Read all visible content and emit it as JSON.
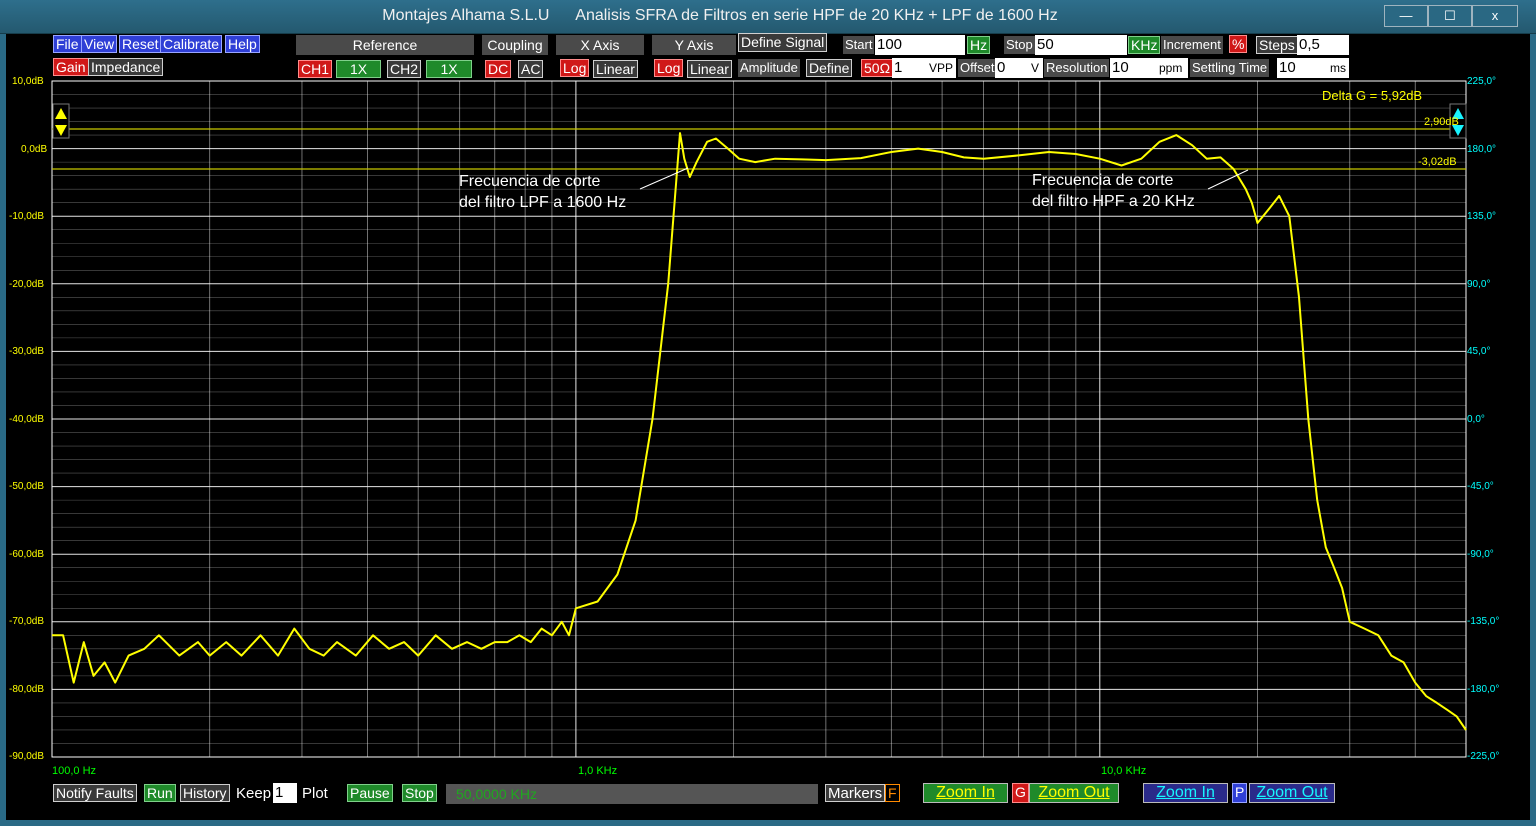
{
  "window": {
    "title": "Montajes Alhama S.L.U      Analisis SFRA de Filtros en serie HPF de 20 KHz + LPF de 1600 Hz",
    "minimize": "—",
    "maximize": "☐",
    "close": "x"
  },
  "menu": [
    "File",
    "View",
    "Reset",
    "Calibrate",
    "Help"
  ],
  "mode": {
    "gain": "Gain",
    "impedance": "Impedance"
  },
  "headers": {
    "reference": "Reference",
    "coupling": "Coupling",
    "x_axis": "X Axis",
    "y_axis": "Y Axis"
  },
  "reference": {
    "ch1": "CH1",
    "ch1_scale": "1X",
    "ch2": "CH2",
    "ch2_scale": "1X"
  },
  "coupling": {
    "dc": "DC",
    "ac": "AC"
  },
  "x_axis": {
    "log": "Log",
    "linear": "Linear"
  },
  "y_axis": {
    "log": "Log",
    "linear": "Linear"
  },
  "signal": {
    "define_signal": "Define Signal",
    "start_label": "Start",
    "start_value": "100",
    "start_unit": "Hz",
    "stop_label": "Stop",
    "stop_value": "50",
    "stop_unit": "KHz",
    "increment_label": "Increment",
    "increment_unit": "%",
    "steps_label": "Steps",
    "steps_value": "0,5",
    "amplitude_label": "Amplitude",
    "define": "Define",
    "impedance": "50Ω",
    "amplitude_value": "1",
    "amplitude_unit": "VPP",
    "offset_label": "Offset",
    "offset_value": "0",
    "offset_unit": "V",
    "resolution_label": "Resolution",
    "resolution_value": "10",
    "resolution_unit": "ppm",
    "settling_label": "Settling Time",
    "settling_value": "10",
    "settling_unit": "ms"
  },
  "plot": {
    "delta_g": "Delta G = 5,92dB",
    "cursor_upper": "2,90dB",
    "cursor_lower": "-3,02dB",
    "annotation_lpf": [
      "Frecuencia de corte",
      "del filtro LPF a 1600 Hz"
    ],
    "annotation_hpf": [
      "Frecuencia de corte",
      "del filtro HPF a 20 KHz"
    ],
    "gain_ticks": [
      "10,0dB",
      "0,0dB",
      "-10,0dB",
      "-20,0dB",
      "-30,0dB",
      "-40,0dB",
      "-50,0dB",
      "-60,0dB",
      "-70,0dB",
      "-80,0dB",
      "-90,0dB"
    ],
    "phase_ticks": [
      "225,0°",
      "180,0°",
      "135,0°",
      "90,0°",
      "45,0°",
      "0,0°",
      "-45,0°",
      "-90,0°",
      "-135,0°",
      "-180,0°",
      "-225,0°"
    ],
    "freq_ticks": [
      "100,0 Hz",
      "1,0 KHz",
      "10,0 KHz"
    ],
    "trace_color": "#ffff00",
    "grid_color": "#ffffff"
  },
  "chart_data": {
    "type": "line",
    "xscale": "log",
    "xlim": [
      100,
      50000
    ],
    "ylim": [
      -90,
      10
    ],
    "y2lim": [
      -225,
      225
    ],
    "series": [
      {
        "x": [
          100,
          105,
          110,
          115,
          120,
          126,
          132,
          140,
          150,
          160,
          175,
          190,
          200,
          215,
          230,
          250,
          270,
          290,
          310,
          330,
          350,
          380,
          410,
          440,
          470,
          500,
          540,
          580,
          620,
          660,
          700,
          740,
          780,
          820,
          860,
          900,
          940,
          970,
          1000,
          1100,
          1200,
          1300,
          1400,
          1500,
          1580,
          1610,
          1650,
          1700,
          1780,
          1850,
          1950,
          2050,
          2200,
          2400,
          2700,
          3000,
          3500,
          4000,
          4500,
          5000,
          5500,
          6000,
          7000,
          8000,
          9000,
          10000,
          11000,
          12000,
          13000,
          14000,
          15000,
          16000,
          17000,
          18000,
          19000,
          19500,
          20000,
          21000,
          22000,
          23000,
          24000,
          25000,
          26000,
          27000,
          28000,
          29000,
          30000,
          32000,
          34000,
          36000,
          38000,
          40000,
          42000,
          44000,
          46000,
          48000,
          50000
        ],
        "y": [
          -72,
          -72,
          -79,
          -73,
          -78,
          -76,
          -79,
          -75,
          -74,
          -72,
          -75,
          -73,
          -75,
          -73,
          -75,
          -72,
          -75,
          -71,
          -74,
          -75,
          -73,
          -75,
          -72,
          -74,
          -73,
          -75,
          -72,
          -74,
          -73,
          -74,
          -73,
          -73,
          -72,
          -73,
          -71,
          -72,
          -70,
          -72,
          -68,
          -67,
          -63,
          -55,
          -40,
          -20,
          2.3,
          -1.5,
          -4.2,
          -2,
          1,
          1.5,
          0,
          -1.5,
          -2,
          -1.5,
          -1.6,
          -1.7,
          -1.4,
          -0.5,
          0,
          -0.5,
          -1.3,
          -1.5,
          -1,
          -0.5,
          -0.8,
          -1.5,
          -2.5,
          -1.5,
          1,
          2,
          0.5,
          -1.5,
          -1.3,
          -3,
          -6,
          -8,
          -11,
          -9,
          -7,
          -10,
          -22,
          -40,
          -52,
          -59,
          -62,
          -65,
          -70,
          -71,
          -72,
          -75,
          -76,
          -79,
          -81,
          -82,
          -83,
          -84,
          -86
        ]
      }
    ]
  },
  "bottom": {
    "notify": "Notify Faults",
    "run": "Run",
    "history": "History",
    "keep_label": "Keep",
    "keep_value": "1",
    "plot_label": "Plot",
    "pause": "Pause",
    "stop": "Stop",
    "status": "50,0000 KHz",
    "markers": "Markers",
    "markers_f": "F",
    "zoom_in_g": "Zoom In",
    "g_label": "G",
    "zoom_out_g": "Zoom Out",
    "zoom_in_p": "Zoom In",
    "p_label": "P",
    "zoom_out_p": "Zoom Out"
  }
}
